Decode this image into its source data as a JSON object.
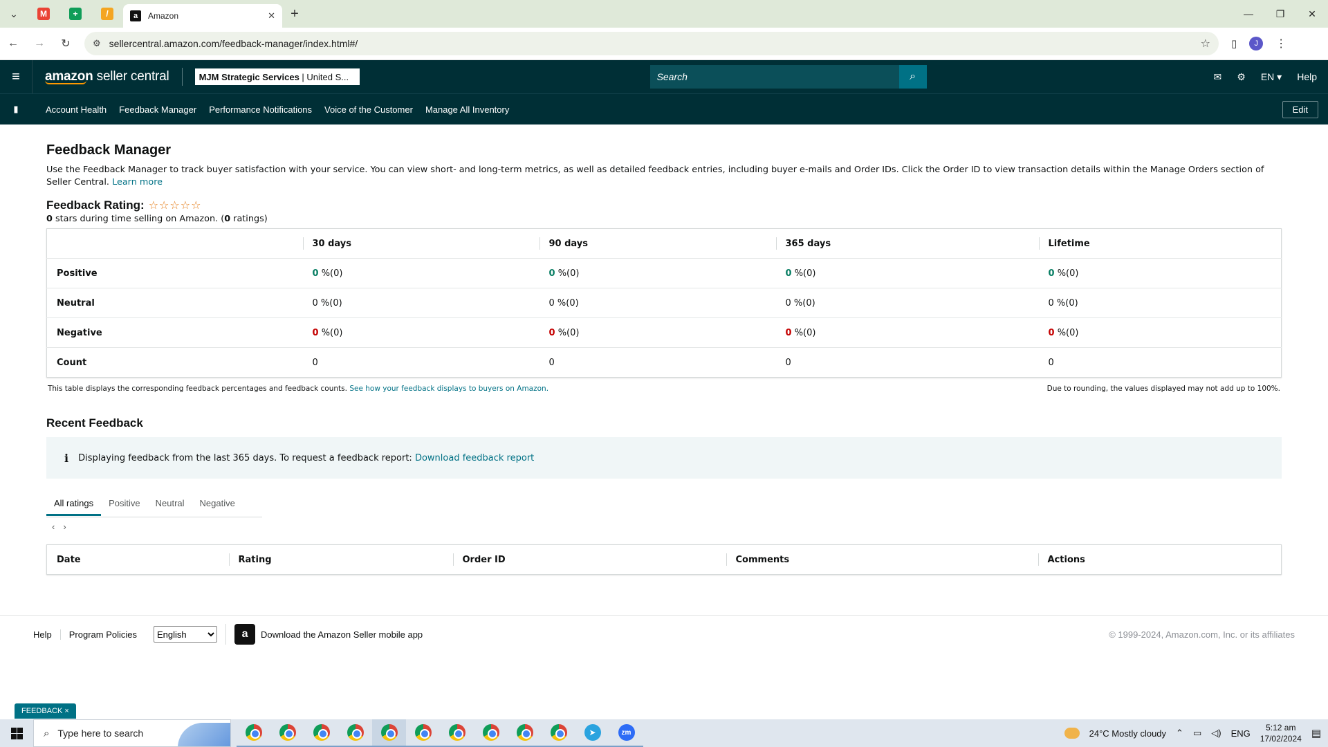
{
  "browser": {
    "tab_title": "Amazon",
    "url": "sellercentral.amazon.com/feedback-manager/index.html#/"
  },
  "header": {
    "logo": "amazon seller central",
    "logo_brand": "amazon",
    "logo_product": "seller central",
    "account_name": "MJM Strategic Services",
    "account_region": "| United S...",
    "search_placeholder": "Search",
    "language": "EN ▾",
    "help": "Help"
  },
  "nav": {
    "items": [
      "Account Health",
      "Feedback Manager",
      "Performance Notifications",
      "Voice of the Customer",
      "Manage All Inventory"
    ],
    "edit": "Edit"
  },
  "main": {
    "title": "Feedback Manager",
    "intro": "Use the Feedback Manager to track buyer satisfaction with your service. You can view short- and long-term metrics, as well as detailed feedback entries, including buyer e-mails and Order IDs. Click the Order ID to view transaction details within the Manage Orders section of Seller Central.",
    "learn_more": "Learn more",
    "rating_label": "Feedback Rating:",
    "stars": "☆☆☆☆☆",
    "stars_count": "0",
    "stars_text": "stars during time selling on Amazon. (",
    "ratings_count": "0",
    "ratings_text": "ratings)"
  },
  "metrics": {
    "columns": [
      "30 days",
      "90 days",
      "365 days",
      "Lifetime"
    ],
    "rows": {
      "positive": "Positive",
      "neutral": "Neutral",
      "negative": "Negative",
      "count": "Count"
    },
    "value": "0",
    "pct": "%(0)",
    "count_value": "0",
    "footer_left": "This table displays the corresponding feedback percentages and feedback counts.",
    "footer_link": "See how your feedback displays to buyers on Amazon.",
    "footer_right": "Due to rounding, the values displayed may not add up to 100%."
  },
  "recent": {
    "title": "Recent Feedback",
    "info_text": "Displaying feedback from the last 365 days. To request a feedback report:",
    "info_link": "Download feedback report",
    "tabs": [
      "All ratings",
      "Positive",
      "Neutral",
      "Negative"
    ],
    "columns": [
      "Date",
      "Rating",
      "Order ID",
      "Comments",
      "Actions"
    ]
  },
  "footer": {
    "help": "Help",
    "policies": "Program Policies",
    "language": "English",
    "app": "Download the Amazon Seller mobile app",
    "copyright": "© 1999-2024, Amazon.com, Inc. or its affiliates"
  },
  "feedback_tab": "FEEDBACK ×",
  "taskbar": {
    "search": "Type here to search",
    "weather": "24°C  Mostly cloudy",
    "lang": "ENG",
    "time": "5:12 am",
    "date": "17/02/2024"
  },
  "colors": {
    "header_bg": "#002f36",
    "link": "#007185",
    "positive": "#067d62",
    "negative": "#c40000"
  }
}
